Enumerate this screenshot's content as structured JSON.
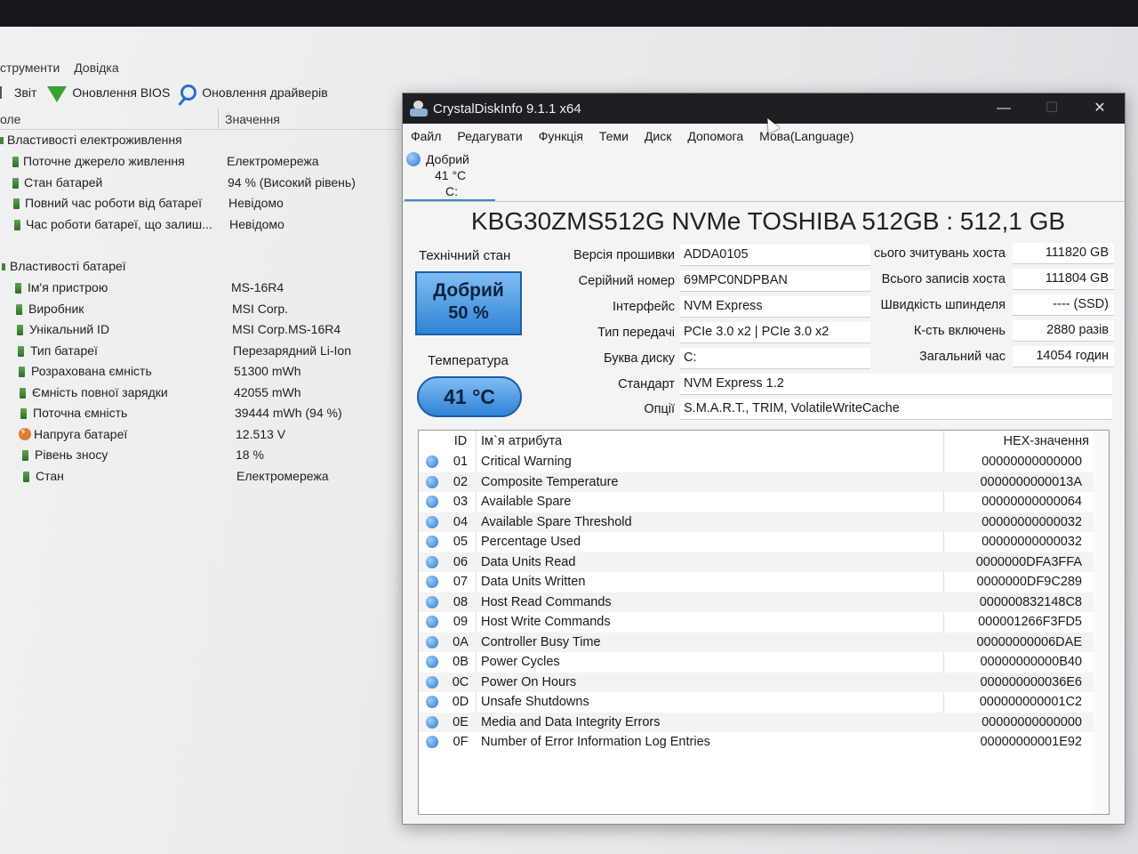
{
  "background_app": {
    "menu": [
      "струменти",
      "Довідка"
    ],
    "toolbar": {
      "report": "Звіт",
      "bios_update": "Оновлення BIOS",
      "driver_update": "Оновлення драйверів"
    },
    "columns": {
      "field": "оле",
      "value": "Значення"
    },
    "groups": [
      {
        "label": "Властивості електроживлення",
        "rows": [
          {
            "label": "Поточне джерело живлення",
            "value": "Електромережа"
          },
          {
            "label": "Стан батарей",
            "value": "94 % (Високий рівень)"
          },
          {
            "label": "Повний час роботи від батареї",
            "value": "Невідомо"
          },
          {
            "label": "Час роботи батареї, що залиш...",
            "value": "Невідомо"
          }
        ]
      },
      {
        "label": "Властивості батареї",
        "rows": [
          {
            "label": "Ім'я пристрою",
            "value": "MS-16R4"
          },
          {
            "label": "Виробник",
            "value": "MSI Corp."
          },
          {
            "label": "Унікальний ID",
            "value": "MSI Corp.MS-16R4"
          },
          {
            "label": "Тип батареї",
            "value": "Перезарядний Li-Ion"
          },
          {
            "label": "Розрахована ємність",
            "value": "51300 mWh"
          },
          {
            "label": "Ємність повної зарядки",
            "value": "42055 mWh"
          },
          {
            "label": "Поточна ємність",
            "value": "39444 mWh  (94 %)"
          },
          {
            "label": "Напруга батареї",
            "value": "12.513 V",
            "icon": "bolt-icon"
          },
          {
            "label": "Рівень зносу",
            "value": "18 %"
          },
          {
            "label": "Стан",
            "value": "Електромережа"
          }
        ]
      }
    ]
  },
  "cdi": {
    "title": "CrystalDiskInfo 9.1.1 x64",
    "window_buttons": {
      "minimize": "—",
      "maximize": "☐",
      "close": "✕"
    },
    "menu": [
      "Файл",
      "Редагувати",
      "Функція",
      "Теми",
      "Диск",
      "Допомога",
      "Мова(Language)"
    ],
    "disk_tab": {
      "status": "Добрий",
      "temp": "41 °C",
      "letter": "C:"
    },
    "model": "KBG30ZMS512G NVMe TOSHIBA 512GB : 512,1 GB",
    "health": {
      "label": "Технічний стан",
      "status": "Добрий",
      "percent": "50 %"
    },
    "temperature": {
      "label": "Температура",
      "value": "41 °C"
    },
    "info": [
      {
        "label": "Версія прошивки",
        "value": "ADDA0105"
      },
      {
        "label": "Серійний номер",
        "value": "69MPC0NDPBAN"
      },
      {
        "label": "Інтерфейс",
        "value": "NVM Express"
      },
      {
        "label": "Тип передачі",
        "value": "PCIe 3.0 x2 | PCIe 3.0 x2"
      },
      {
        "label": "Буква диску",
        "value": "C:"
      },
      {
        "label": "Стандарт",
        "value": "NVM Express 1.2"
      },
      {
        "label": "Опції",
        "value": "S.M.A.R.T., TRIM, VolatileWriteCache"
      }
    ],
    "right_info": [
      {
        "label": "сього зчитувань хоста",
        "value": "111820 GB"
      },
      {
        "label": "Всього записів хоста",
        "value": "111804 GB"
      },
      {
        "label": "Швидкість шпинделя",
        "value": "---- (SSD)"
      },
      {
        "label": "К-сть включень",
        "value": "2880 разів"
      },
      {
        "label": "Загальний час",
        "value": "14054 годин"
      }
    ],
    "table": {
      "headers": {
        "id": "ID",
        "name": "Ім`я атрибута",
        "hex": "HEX-значення"
      },
      "rows": [
        {
          "id": "01",
          "name": "Critical Warning",
          "hex": "00000000000000"
        },
        {
          "id": "02",
          "name": "Composite Temperature",
          "hex": "0000000000013A"
        },
        {
          "id": "03",
          "name": "Available Spare",
          "hex": "00000000000064"
        },
        {
          "id": "04",
          "name": "Available Spare Threshold",
          "hex": "00000000000032"
        },
        {
          "id": "05",
          "name": "Percentage Used",
          "hex": "00000000000032"
        },
        {
          "id": "06",
          "name": "Data Units Read",
          "hex": "0000000DFA3FFA"
        },
        {
          "id": "07",
          "name": "Data Units Written",
          "hex": "0000000DF9C289"
        },
        {
          "id": "08",
          "name": "Host Read Commands",
          "hex": "000000832148C8"
        },
        {
          "id": "09",
          "name": "Host Write Commands",
          "hex": "000001266F3FD5"
        },
        {
          "id": "0A",
          "name": "Controller Busy Time",
          "hex": "00000000006DAE"
        },
        {
          "id": "0B",
          "name": "Power Cycles",
          "hex": "00000000000B40"
        },
        {
          "id": "0C",
          "name": "Power On Hours",
          "hex": "000000000036E6"
        },
        {
          "id": "0D",
          "name": "Unsafe Shutdowns",
          "hex": "000000000001C2"
        },
        {
          "id": "0E",
          "name": "Media and Data Integrity Errors",
          "hex": "00000000000000"
        },
        {
          "id": "0F",
          "name": "Number of Error Information Log Entries",
          "hex": "00000000001E92"
        }
      ]
    }
  }
}
